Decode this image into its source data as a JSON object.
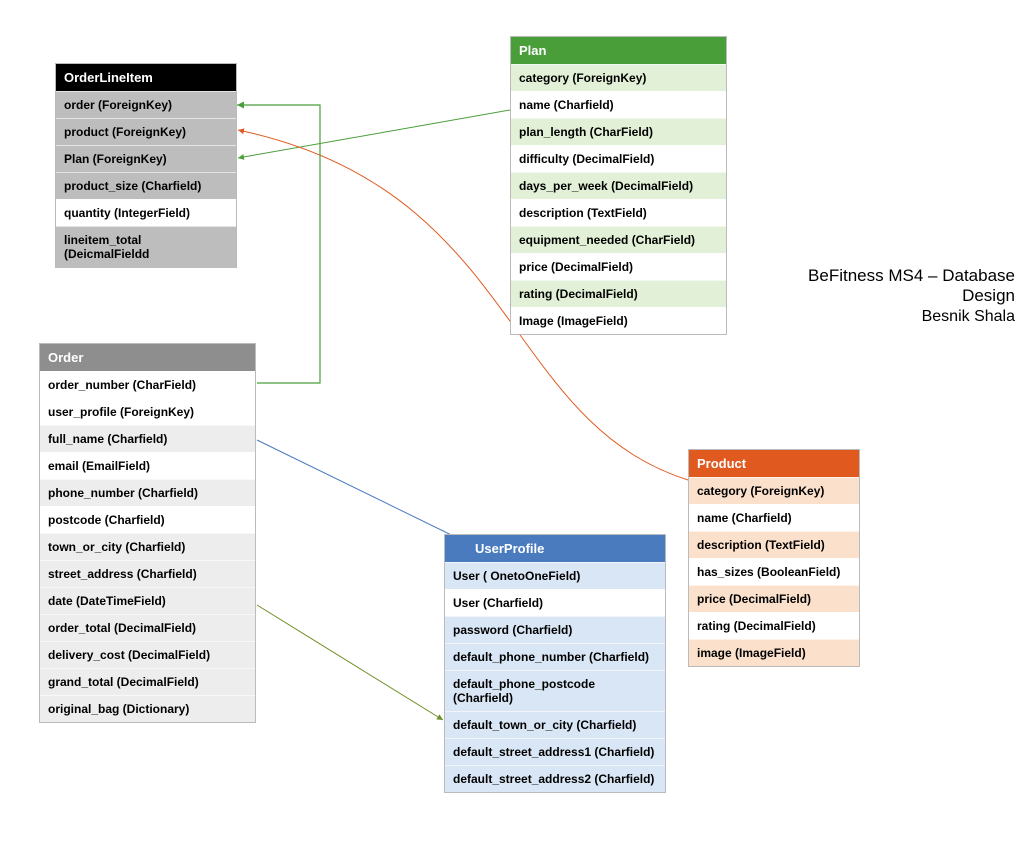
{
  "title": {
    "line1": "BeFitness MS4 – Database Design",
    "line2": "Besnik Shala"
  },
  "entities": {
    "orderLineItem": {
      "header": "OrderLineItem",
      "rows": [
        {
          "t": "order (ForeignKey)",
          "s": ""
        },
        {
          "t": "product (ForeignKey)",
          "s": ""
        },
        {
          "t": "Plan (ForeignKey)",
          "s": ""
        },
        {
          "t": "product_size (Charfield)",
          "s": ""
        },
        {
          "t": "quantity (IntegerField)",
          "s": "light"
        },
        {
          "t": "lineitem_total (DeicmalFieldd",
          "s": ""
        }
      ]
    },
    "plan": {
      "header": "Plan",
      "rows": [
        {
          "t": "category (ForeignKey)",
          "s": ""
        },
        {
          "t": "name (Charfield)",
          "s": "light"
        },
        {
          "t": "plan_length (CharField)",
          "s": ""
        },
        {
          "t": "difficulty (DecimalField)",
          "s": "light"
        },
        {
          "t": "days_per_week (DecimalField)",
          "s": ""
        },
        {
          "t": "description (TextField)",
          "s": "light"
        },
        {
          "t": "equipment_needed (CharField)",
          "s": ""
        },
        {
          "t": "price (DecimalField)",
          "s": "light"
        },
        {
          "t": "rating (DecimalField)",
          "s": ""
        },
        {
          "t": "Image (ImageField)",
          "s": "light"
        }
      ]
    },
    "order": {
      "header": "Order",
      "rows": [
        {
          "t": "order_number (CharField)",
          "s": "light"
        },
        {
          "t": "user_profile (ForeignKey)",
          "s": "light"
        },
        {
          "t": "full_name (Charfield)",
          "s": ""
        },
        {
          "t": "email (EmailField)",
          "s": "light"
        },
        {
          "t": "phone_number (Charfield)",
          "s": ""
        },
        {
          "t": "postcode (Charfield)",
          "s": "light"
        },
        {
          "t": "town_or_city (Charfield)",
          "s": ""
        },
        {
          "t": "street_address (Charfield)",
          "s": ""
        },
        {
          "t": "date (DateTimeField)",
          "s": ""
        },
        {
          "t": "order_total (DecimalField)",
          "s": ""
        },
        {
          "t": "delivery_cost (DecimalField)",
          "s": ""
        },
        {
          "t": "grand_total (DecimalField)",
          "s": ""
        },
        {
          "t": "original_bag (Dictionary)",
          "s": ""
        }
      ]
    },
    "product": {
      "header": "Product",
      "rows": [
        {
          "t": "category (ForeignKey)",
          "s": ""
        },
        {
          "t": "name (Charfield)",
          "s": "light"
        },
        {
          "t": "description (TextField)",
          "s": ""
        },
        {
          "t": "has_sizes (BooleanField)",
          "s": "light"
        },
        {
          "t": "price (DecimalField)",
          "s": ""
        },
        {
          "t": "rating (DecimalField)",
          "s": "light"
        },
        {
          "t": "image (ImageField)",
          "s": ""
        }
      ]
    },
    "userProfile": {
      "header": "UserProfile",
      "rows": [
        {
          "t": "User   ( OnetoOneField)",
          "s": ""
        },
        {
          "t": "User  (Charfield)",
          "s": "light"
        },
        {
          "t": "password (Charfield)",
          "s": ""
        },
        {
          "t": "default_phone_number (Charfield)",
          "s": ""
        },
        {
          "t": "default_phone_postcode (Charfield)",
          "s": ""
        },
        {
          "t": "default_town_or_city (Charfield)",
          "s": ""
        },
        {
          "t": "default_street_address1 (Charfield)",
          "s": ""
        },
        {
          "t": "default_street_address2 (Charfield)",
          "s": ""
        }
      ]
    }
  }
}
